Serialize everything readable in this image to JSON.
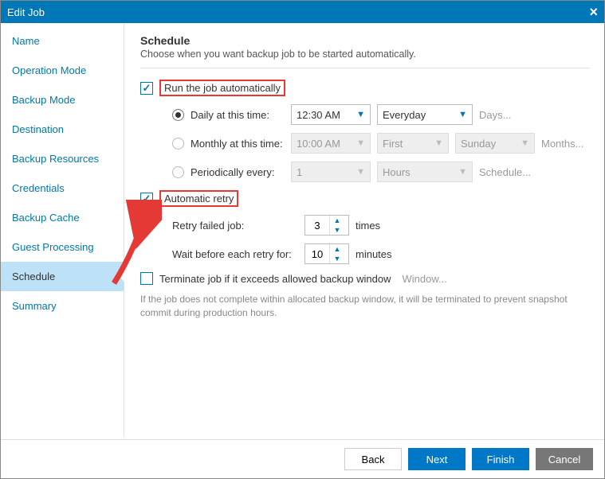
{
  "window": {
    "title": "Edit Job"
  },
  "sidebar": {
    "items": [
      {
        "label": "Name"
      },
      {
        "label": "Operation Mode"
      },
      {
        "label": "Backup Mode"
      },
      {
        "label": "Destination"
      },
      {
        "label": "Backup Resources"
      },
      {
        "label": "Credentials"
      },
      {
        "label": "Backup Cache"
      },
      {
        "label": "Guest Processing"
      },
      {
        "label": "Schedule"
      },
      {
        "label": "Summary"
      }
    ],
    "active_index": 8
  },
  "main": {
    "heading": "Schedule",
    "subheading": "Choose when you want backup job to be started automatically.",
    "run_auto": {
      "checked": true,
      "label": "Run the job automatically"
    },
    "daily": {
      "selected": true,
      "label": "Daily at this time:",
      "time": "12:30 AM",
      "day": "Everyday",
      "link": "Days..."
    },
    "monthly": {
      "selected": false,
      "label": "Monthly at this time:",
      "time": "10:00 AM",
      "ord": "First",
      "weekday": "Sunday",
      "link": "Months..."
    },
    "periodic": {
      "selected": false,
      "label": "Periodically every:",
      "value": "1",
      "unit": "Hours",
      "link": "Schedule..."
    },
    "auto_retry": {
      "checked": true,
      "label": "Automatic retry"
    },
    "retry": {
      "label": "Retry failed job:",
      "value": "3",
      "suffix": "times"
    },
    "wait": {
      "label": "Wait before each retry for:",
      "value": "10",
      "suffix": "minutes"
    },
    "terminate": {
      "checked": false,
      "label": "Terminate job if it exceeds allowed backup window",
      "link": "Window..."
    },
    "fineprint": "If the job does not complete within allocated backup window, it will be terminated to prevent snapshot commit during production hours."
  },
  "footer": {
    "back": "Back",
    "next": "Next",
    "finish": "Finish",
    "cancel": "Cancel"
  }
}
